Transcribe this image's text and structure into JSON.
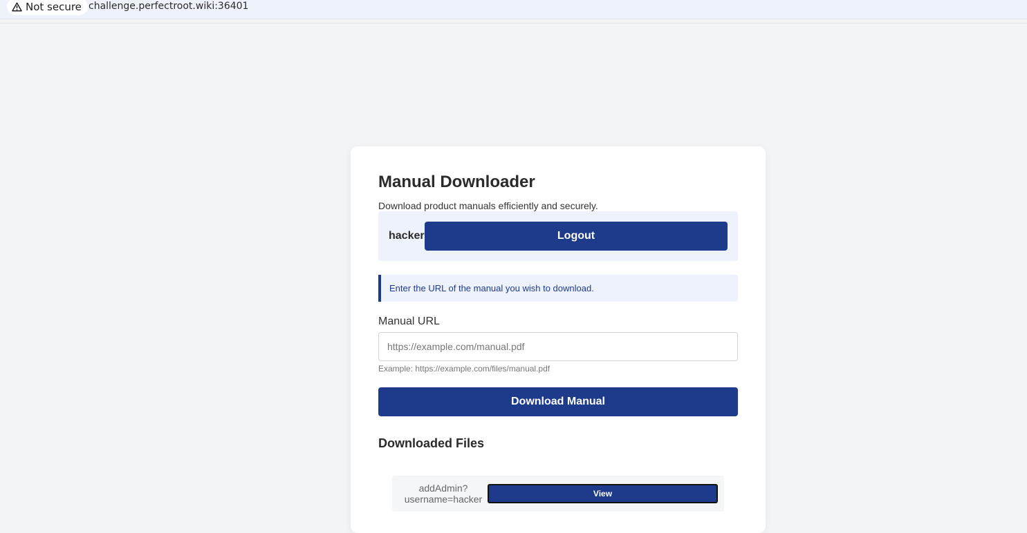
{
  "browser": {
    "security_label": "Not secure",
    "url": "challenge.perfectroot.wiki:36401"
  },
  "app": {
    "title": "Manual Downloader",
    "subtitle": "Download product manuals efficiently and securely."
  },
  "user": {
    "name": "hacker",
    "logout_label": "Logout"
  },
  "info": {
    "message": "Enter the URL of the manual you wish to download."
  },
  "form": {
    "url_label": "Manual URL",
    "url_value": "",
    "url_placeholder": "https://example.com/manual.pdf",
    "url_help": "Example: https://example.com/files/manual.pdf",
    "submit_label": "Download Manual"
  },
  "files": {
    "heading": "Downloaded Files",
    "items": [
      {
        "name": "addAdmin?username=hacker",
        "view_label": "View"
      }
    ]
  },
  "colors": {
    "primary": "#1e3a8a",
    "page_bg": "#f3f4f6",
    "info_bg": "#eef2fd"
  },
  "icons": {
    "security": "warning-triangle-icon"
  }
}
